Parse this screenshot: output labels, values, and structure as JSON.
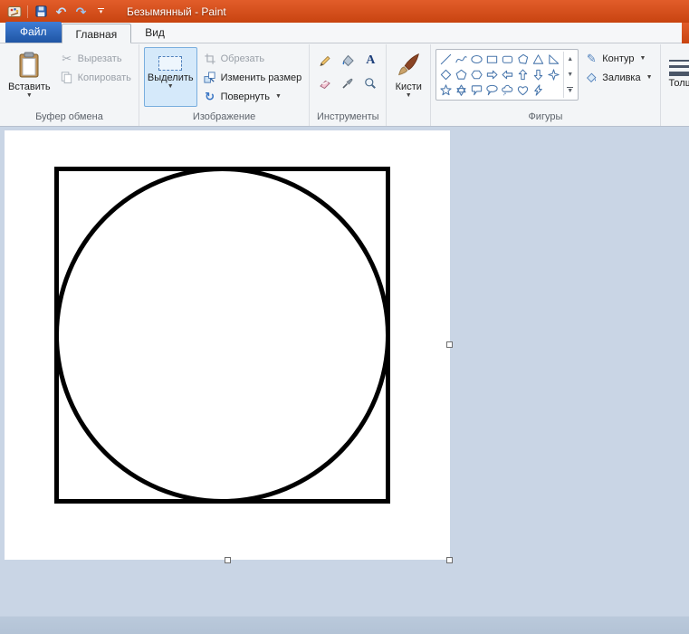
{
  "titlebar": {
    "title": "Безымянный - Paint"
  },
  "tabs": {
    "file": "Файл",
    "home": "Главная",
    "view": "Вид"
  },
  "ribbon": {
    "clipboard": {
      "label": "Буфер обмена",
      "paste": "Вставить",
      "cut": "Вырезать",
      "copy": "Копировать"
    },
    "image": {
      "label": "Изображение",
      "select": "Выделить",
      "crop": "Обрезать",
      "resize": "Изменить размер",
      "rotate": "Повернуть"
    },
    "tools": {
      "label": "Инструменты",
      "text_glyph": "A",
      "items": [
        "pencil",
        "fill",
        "text",
        "eraser",
        "color-picker",
        "magnifier"
      ]
    },
    "brushes": {
      "label": "Кисти"
    },
    "shapes": {
      "label": "Фигуры",
      "outline": "Контур",
      "fill": "Заливка",
      "items": [
        "line",
        "curve",
        "oval",
        "rectangle",
        "rounded-rectangle",
        "polygon",
        "triangle",
        "right-triangle",
        "diamond",
        "pentagon",
        "hexagon",
        "right-arrow",
        "left-arrow",
        "up-arrow",
        "down-arrow",
        "four-point-star",
        "five-point-star",
        "six-point-star",
        "rounded-callout",
        "oval-callout",
        "cloud-callout",
        "heart",
        "lightning"
      ]
    },
    "thickness": {
      "label": "Толщ"
    }
  },
  "colors": {
    "titlebar": "#cc4712",
    "file_tab": "#2a64b4",
    "select_highlight": "#d5e9fa",
    "workarea": "#c9d5e5",
    "shape_stroke": "#4876ac"
  }
}
